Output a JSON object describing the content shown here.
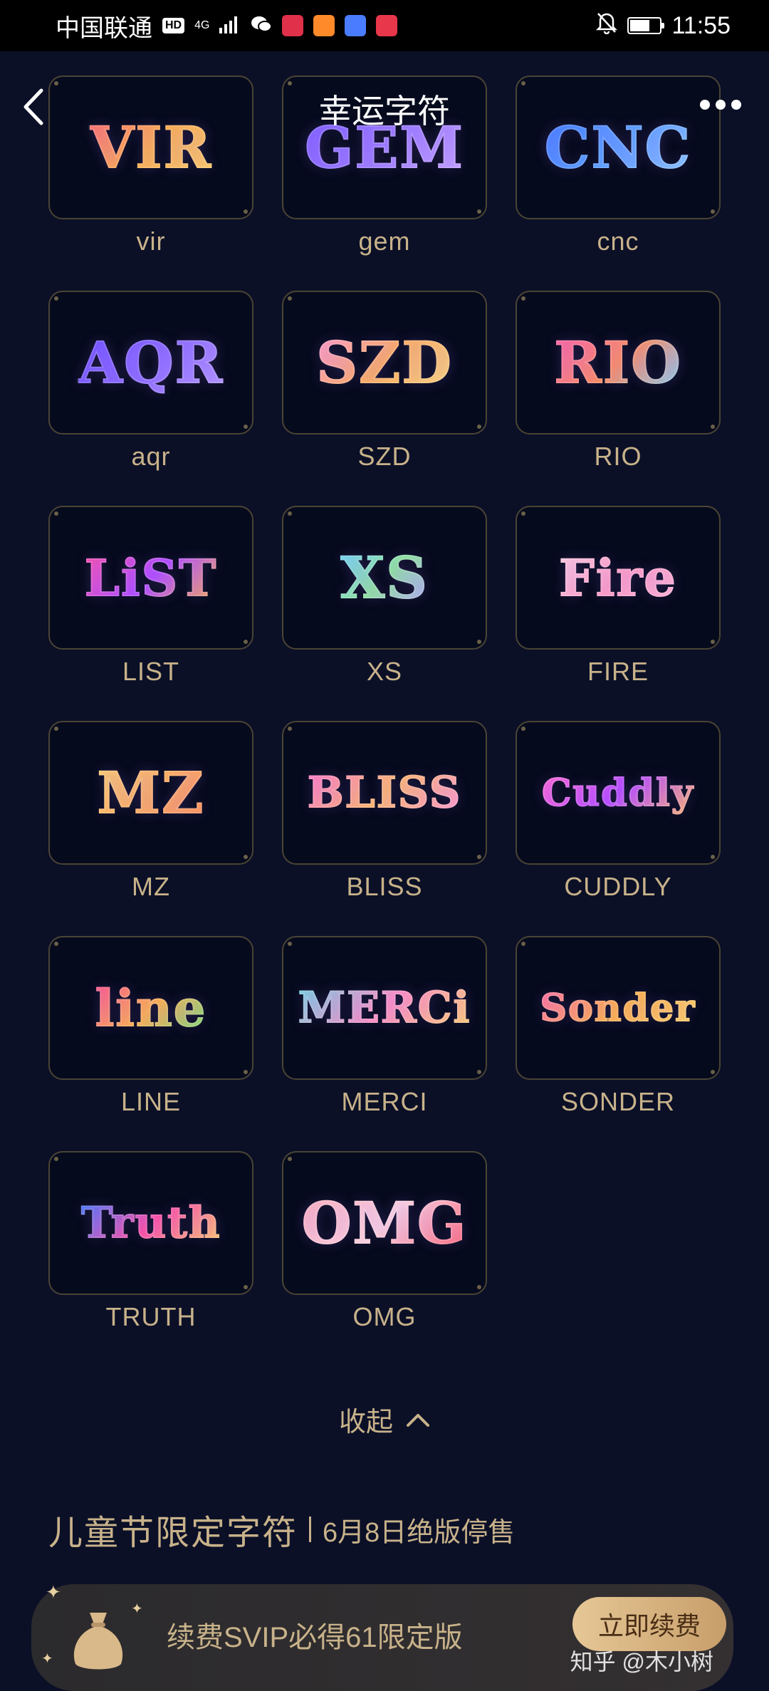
{
  "status_bar": {
    "carrier": "中国联通",
    "hd": "HD",
    "net": "4G",
    "time": "11:55"
  },
  "header": {
    "title": "幸运字符"
  },
  "symbols": [
    {
      "label": "vir",
      "art": "VIR",
      "colors": [
        "#ff6b6b",
        "#ffb347",
        "#ffd166"
      ]
    },
    {
      "label": "gem",
      "art": "GEM",
      "colors": [
        "#7b5cff",
        "#9b7bff",
        "#c9a8ff"
      ]
    },
    {
      "label": "cnc",
      "art": "CNC",
      "colors": [
        "#3d7bff",
        "#5aa0ff",
        "#8fc8ff"
      ]
    },
    {
      "label": "aqr",
      "art": "AQR",
      "colors": [
        "#6a4bff",
        "#8a6bff",
        "#b69bff"
      ]
    },
    {
      "label": "SZD",
      "art": "SZD",
      "colors": [
        "#ff9ad1",
        "#ffb05a",
        "#ffe07a"
      ]
    },
    {
      "label": "RIO",
      "art": "RIO",
      "colors": [
        "#ff5ea8",
        "#ff8f5a",
        "#7bd8ff"
      ]
    },
    {
      "label": "LIST",
      "art": "LiST",
      "colors": [
        "#ff4fa3",
        "#b04bff",
        "#ffb347"
      ]
    },
    {
      "label": "XS",
      "art": "XS",
      "colors": [
        "#6fd6ff",
        "#8fe89a",
        "#b7a6ff"
      ]
    },
    {
      "label": "FIRE",
      "art": "Fire",
      "colors": [
        "#ffd1e0",
        "#ff9ec2",
        "#ffb6d3"
      ]
    },
    {
      "label": "MZ",
      "art": "MZ",
      "colors": [
        "#ffd36b",
        "#ffb05a",
        "#ff8f5a"
      ]
    },
    {
      "label": "BLISS",
      "art": "BLISS",
      "colors": [
        "#ff7ac8",
        "#ffb86b",
        "#ff9ad1"
      ]
    },
    {
      "label": "CUDDLY",
      "art": "Cuddly",
      "colors": [
        "#ff6ad0",
        "#b84bff",
        "#ffb86b"
      ]
    },
    {
      "label": "LINE",
      "art": "line",
      "colors": [
        "#ff4f8f",
        "#ffb347",
        "#6fe07a"
      ]
    },
    {
      "label": "MERCI",
      "art": "MERCi",
      "colors": [
        "#6fd6e0",
        "#ff8fc0",
        "#ffd36b"
      ]
    },
    {
      "label": "SONDER",
      "art": "Sonder",
      "colors": [
        "#ff6fa0",
        "#ffb347",
        "#ffd166"
      ]
    },
    {
      "label": "TRUTH",
      "art": "Truth",
      "colors": [
        "#3d7bff",
        "#ff4fa3",
        "#ffd166"
      ]
    },
    {
      "label": "OMG",
      "art": "OMG",
      "colors": [
        "#ffb0b8",
        "#ffd6dc",
        "#ff5f6d"
      ]
    }
  ],
  "collapse": {
    "label": "收起"
  },
  "section": {
    "title": "儿童节限定字符",
    "note": "6月8日绝版停售"
  },
  "promo": {
    "text": "续费SVIP必得61限定版",
    "button": "立即续费"
  },
  "watermark": "知乎 @木小树"
}
